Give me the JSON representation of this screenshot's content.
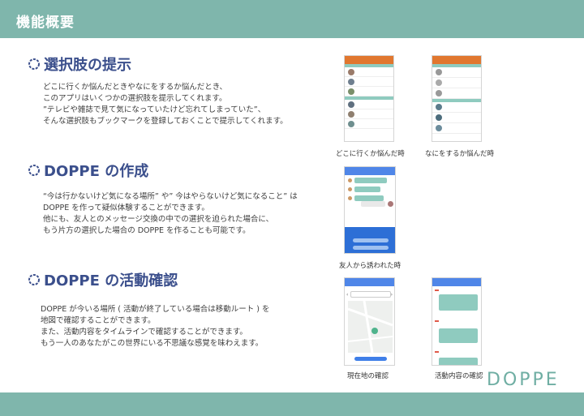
{
  "header": {
    "title": "機能概要"
  },
  "section1": {
    "title": "選択肢の提示",
    "lines": [
      "どこに行くか悩んだときやなにをするか悩んだとき、",
      "このアプリはいくつかの選択肢を提示してくれます。",
      "”テレビや雑誌で見て気になっていたけど忘れてしまっていた”、",
      "そんな選択肢もブックマークを登録しておくことで提示してくれます。"
    ],
    "caption_left": "どこに行くか悩んだ時",
    "caption_right": "なにをするか悩んだ時"
  },
  "section2": {
    "title": "DOPPE の作成",
    "lines": [
      "“今は行かないけど気になる場所” や” 今はやらないけど気になること” は",
      "DOPPE を作って疑似体験することができます。",
      "他にも、友人とのメッセージ交換の中での選択を迫られた場合に、",
      "もう片方の選択した場合の DOPPE を作ることも可能です。"
    ],
    "caption": "友人から誘われた時"
  },
  "section3": {
    "title": "DOPPE の活動確認",
    "lines": [
      "DOPPE が今いる場所 ( 活動が終了している場合は移動ルート ) を",
      "地図で確認することができます。",
      "また、活動内容をタイムラインで確認することができます。",
      "もう一人のあなたがこの世界にいる不思議な感覚を味わえます。"
    ],
    "caption_left": "現在地の確認",
    "caption_right": "活動内容の確認"
  },
  "logo": "DOPPE",
  "colors": {
    "accent": "#7fb6ac",
    "title": "#3b4f8c",
    "orange": "#e1772f",
    "blue": "#4f86e8"
  }
}
